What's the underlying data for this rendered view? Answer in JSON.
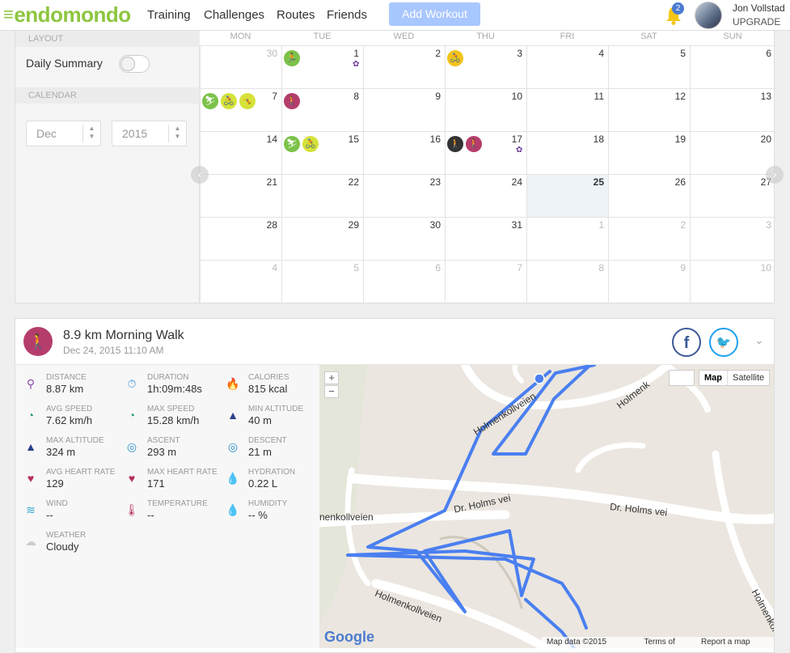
{
  "brand": {
    "logo": "endomondo"
  },
  "nav": {
    "items": [
      "Training",
      "Challenges",
      "Routes",
      "Friends"
    ],
    "add_workout": "Add Workout"
  },
  "notifications": {
    "count": "2"
  },
  "user": {
    "name": "Jon Vollstad",
    "upgrade": "UPGRADE"
  },
  "calendar": {
    "side": {
      "layout_label": "LAYOUT",
      "daily_summary": "Daily Summary",
      "calendar_label": "CALENDAR",
      "month": "Dec",
      "year": "2015"
    },
    "daynames": [
      "MON",
      "TUE",
      "WED",
      "THU",
      "FRI",
      "SAT",
      "SUN"
    ],
    "weeks": [
      [
        "30",
        "1",
        "2",
        "3",
        "4",
        "5",
        "6"
      ],
      [
        "7",
        "8",
        "9",
        "10",
        "11",
        "12",
        "13"
      ],
      [
        "14",
        "15",
        "16",
        "17",
        "18",
        "19",
        "20"
      ],
      [
        "21",
        "22",
        "23",
        "24",
        "25",
        "26",
        "27"
      ],
      [
        "28",
        "29",
        "30",
        "31",
        "1",
        "2",
        "3"
      ],
      [
        "4",
        "5",
        "6",
        "7",
        "8",
        "9",
        "10"
      ]
    ],
    "today": "25",
    "colors": {
      "green": "#7cc24a",
      "yellow": "#f2c31a",
      "lime": "#d5e23a",
      "maroon": "#b53d6b",
      "black": "#333333",
      "medal": "#6b3a9a"
    }
  },
  "workout": {
    "title": "8.9 km Morning Walk",
    "date": "Dec 24, 2015 11:10 AM",
    "stats": [
      {
        "label": "DISTANCE",
        "value": "8.87 km",
        "icon": "pin-icon"
      },
      {
        "label": "DURATION",
        "value": "1h:09m:48s",
        "icon": "stopwatch-icon"
      },
      {
        "label": "CALORIES",
        "value": "815 kcal",
        "icon": "flame-icon"
      },
      {
        "label": "AVG SPEED",
        "value": "7.62 km/h",
        "icon": "speedometer-icon"
      },
      {
        "label": "MAX SPEED",
        "value": "15.28 km/h",
        "icon": "speedometer-icon"
      },
      {
        "label": "MIN ALTITUDE",
        "value": "40 m",
        "icon": "mountain-icon"
      },
      {
        "label": "MAX ALTITUDE",
        "value": "324 m",
        "icon": "mountain-icon"
      },
      {
        "label": "ASCENT",
        "value": "293 m",
        "icon": "compass-icon"
      },
      {
        "label": "DESCENT",
        "value": "21 m",
        "icon": "compass-icon"
      },
      {
        "label": "AVG HEART RATE",
        "value": "129",
        "icon": "heart-icon"
      },
      {
        "label": "MAX HEART RATE",
        "value": "171",
        "icon": "heart-icon"
      },
      {
        "label": "HYDRATION",
        "value": "0.22 L",
        "icon": "droplet-icon"
      },
      {
        "label": "WIND",
        "value": "--",
        "icon": "wind-icon"
      },
      {
        "label": "TEMPERATURE",
        "value": "--",
        "icon": "thermometer-icon"
      },
      {
        "label": "HUMIDITY",
        "value": "-- %",
        "icon": "droplets-icon"
      },
      {
        "label": "WEATHER",
        "value": "Cloudy",
        "icon": "cloud-icon"
      }
    ]
  },
  "map": {
    "map_label": "Map",
    "satellite_label": "Satellite",
    "zoom_in": "+",
    "zoom_out": "−",
    "google": "Google",
    "attribution": [
      "Map data ©2015 Google",
      "Terms of Use",
      "Report a map error"
    ],
    "roads": [
      "Holmenkollveien",
      "Holmenk",
      "Dr. Holms vei",
      "Dr. Holms vei",
      "nenkollveien",
      "Holmenkollveien",
      "Holmenkol"
    ],
    "marker": "8"
  }
}
